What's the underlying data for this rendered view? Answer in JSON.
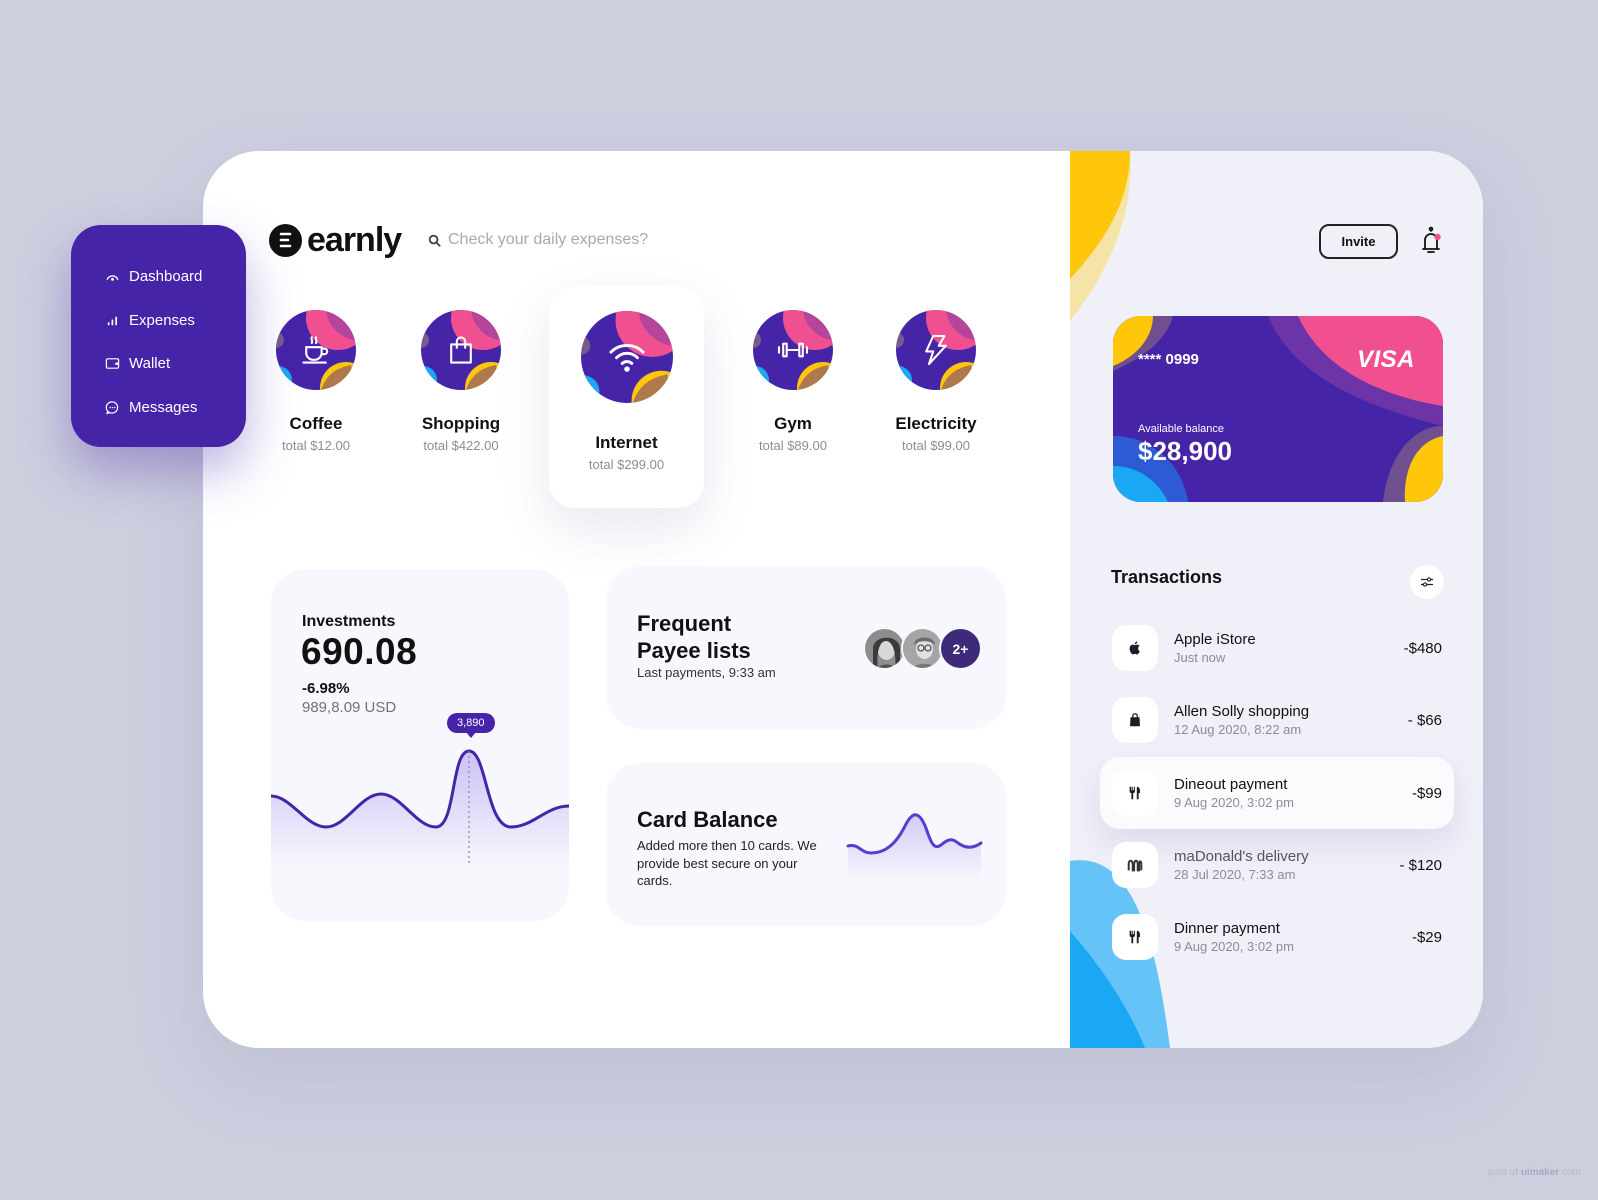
{
  "brand": {
    "name": "earnly"
  },
  "search": {
    "placeholder": "Check your daily expenses?",
    "value": ""
  },
  "sidebar": {
    "items": [
      {
        "label": "Dashboard",
        "icon": "gauge-icon"
      },
      {
        "label": "Expenses",
        "icon": "bar-chart-icon"
      },
      {
        "label": "Wallet",
        "icon": "wallet-icon"
      },
      {
        "label": "Messages",
        "icon": "chat-bubble-icon"
      }
    ]
  },
  "categories": [
    {
      "name": "Coffee",
      "total": "total $12.00",
      "icon": "coffee-cup-icon"
    },
    {
      "name": "Shopping",
      "total": "total $422.00",
      "icon": "shopping-bag-icon"
    },
    {
      "name": "Internet",
      "total": "total $299.00",
      "icon": "wifi-icon",
      "active": true
    },
    {
      "name": "Gym",
      "total": "total $89.00",
      "icon": "dumbbell-icon"
    },
    {
      "name": "Electricity",
      "total": "total $99.00",
      "icon": "lightning-icon"
    }
  ],
  "investments": {
    "label": "Investments",
    "value": "690.08",
    "change": "-6.98%",
    "usd": "989,8.09 USD",
    "tooltip": "3,890"
  },
  "payee": {
    "title": "Frequent Payee lists",
    "subtitle": "Last payments, 9:33 am",
    "more": "2+"
  },
  "card_balance": {
    "title": "Card Balance",
    "description": "Added more then 10 cards. We provide best secure on your cards."
  },
  "header": {
    "invite_label": "Invite"
  },
  "visa_card": {
    "number": "**** 0999",
    "brand": "VISA",
    "balance_label": "Available balance",
    "balance": "$28,900"
  },
  "transactions": {
    "title": "Transactions",
    "items": [
      {
        "title": "Apple iStore",
        "date": "Just now",
        "amount": "-$480",
        "icon": "apple-icon"
      },
      {
        "title": "Allen Solly shopping",
        "date": "12 Aug 2020, 8:22 am",
        "amount": "- $66",
        "icon": "shopping-bag-icon"
      },
      {
        "title": "Dineout payment",
        "date": "9 Aug 2020, 3:02 pm",
        "amount": "-$99",
        "icon": "fork-knife-icon",
        "highlighted": true
      },
      {
        "title": "maDonald's delivery",
        "date": "28 Jul 2020, 7:33 am",
        "amount": "- $120",
        "icon": "mcdonalds-icon"
      },
      {
        "title": "Dinner payment",
        "date": "9 Aug 2020, 3:02 pm",
        "amount": "-$29",
        "icon": "fork-knife-icon"
      }
    ]
  },
  "colors": {
    "primary": "#4524a8",
    "pink": "#f0508f",
    "yellow": "#ffc60a",
    "blue": "#1aa8f5",
    "background": "#cdcfdf",
    "panel": "#f0f0f9"
  },
  "watermark": {
    "prefix": "post of",
    "site": "uimaker",
    "suffix": ".com"
  }
}
